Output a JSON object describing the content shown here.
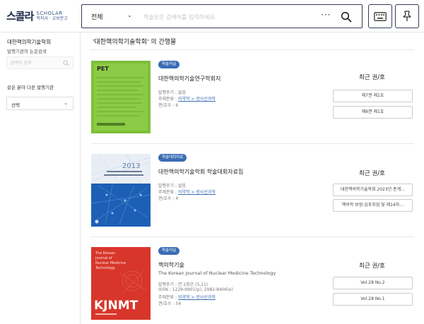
{
  "header": {
    "logo_main": "스콜라",
    "logo_sub1": "SCHOLAR",
    "logo_sub2": "학지사 · 교보문고",
    "scope": "전체",
    "search_placeholder": "학술논문 검색어를 입력하세요.",
    "more": "···"
  },
  "sidebar": {
    "title": "대한핵의학기술학회",
    "subtitle": "발행기관의 논문검색",
    "search_placeholder": "검색어 입력",
    "section": "같은 분야 다른 발행기관",
    "select_value": "선택"
  },
  "main": {
    "title": "'대한핵의학기술학회' 의 간행물",
    "items": [
      {
        "badge": "학술저널",
        "title": "대한핵의학기술연구학회지",
        "freq": "발행주기 : 없음",
        "subject_label": "주제분류 : ",
        "subject_link": "의약학 > 방사선과학",
        "volumes": "권/호수 : 6",
        "recent": "최근 권/호",
        "buttons": [
          "제7권 제1호",
          "제6권 제1호"
        ],
        "cover_text": "PET"
      },
      {
        "badge": "학술대회자료",
        "title": "대한핵의학기술학회 학술대회자료집",
        "freq": "발행주기 : 없음",
        "subject_label": "주제분류 : ",
        "subject_link": "의약학 > 방사선과학",
        "volumes": "권/호수 : 4",
        "recent": "최근 권/호",
        "buttons": [
          "대한핵의학기술학회 2023년 춘계…",
          "핵의학 보험 심포지엄 및 제14차…"
        ],
        "cover_year": "2013"
      },
      {
        "badge": "학술저널",
        "title": "핵의학기술",
        "title_en": "The Korean Journal of Nuclear Medicine Technology",
        "freq": "발행주기 : 연 2회간 (5,11)",
        "issn": "ISSN : 1229-9901(p), 2982-8406(e)",
        "subject_label": "주제분류 : ",
        "subject_link": "의약학 > 방사선과학",
        "volumes": "권/호수 : 54",
        "recent": "최근 권/호",
        "buttons": [
          "Vol.28 No.2",
          "Vol.28 No.1"
        ],
        "cover_lines": [
          "The Korean",
          "Journal of",
          "Nuclear Medicine",
          "Technology"
        ],
        "cover_big": "KJNMT"
      }
    ]
  }
}
